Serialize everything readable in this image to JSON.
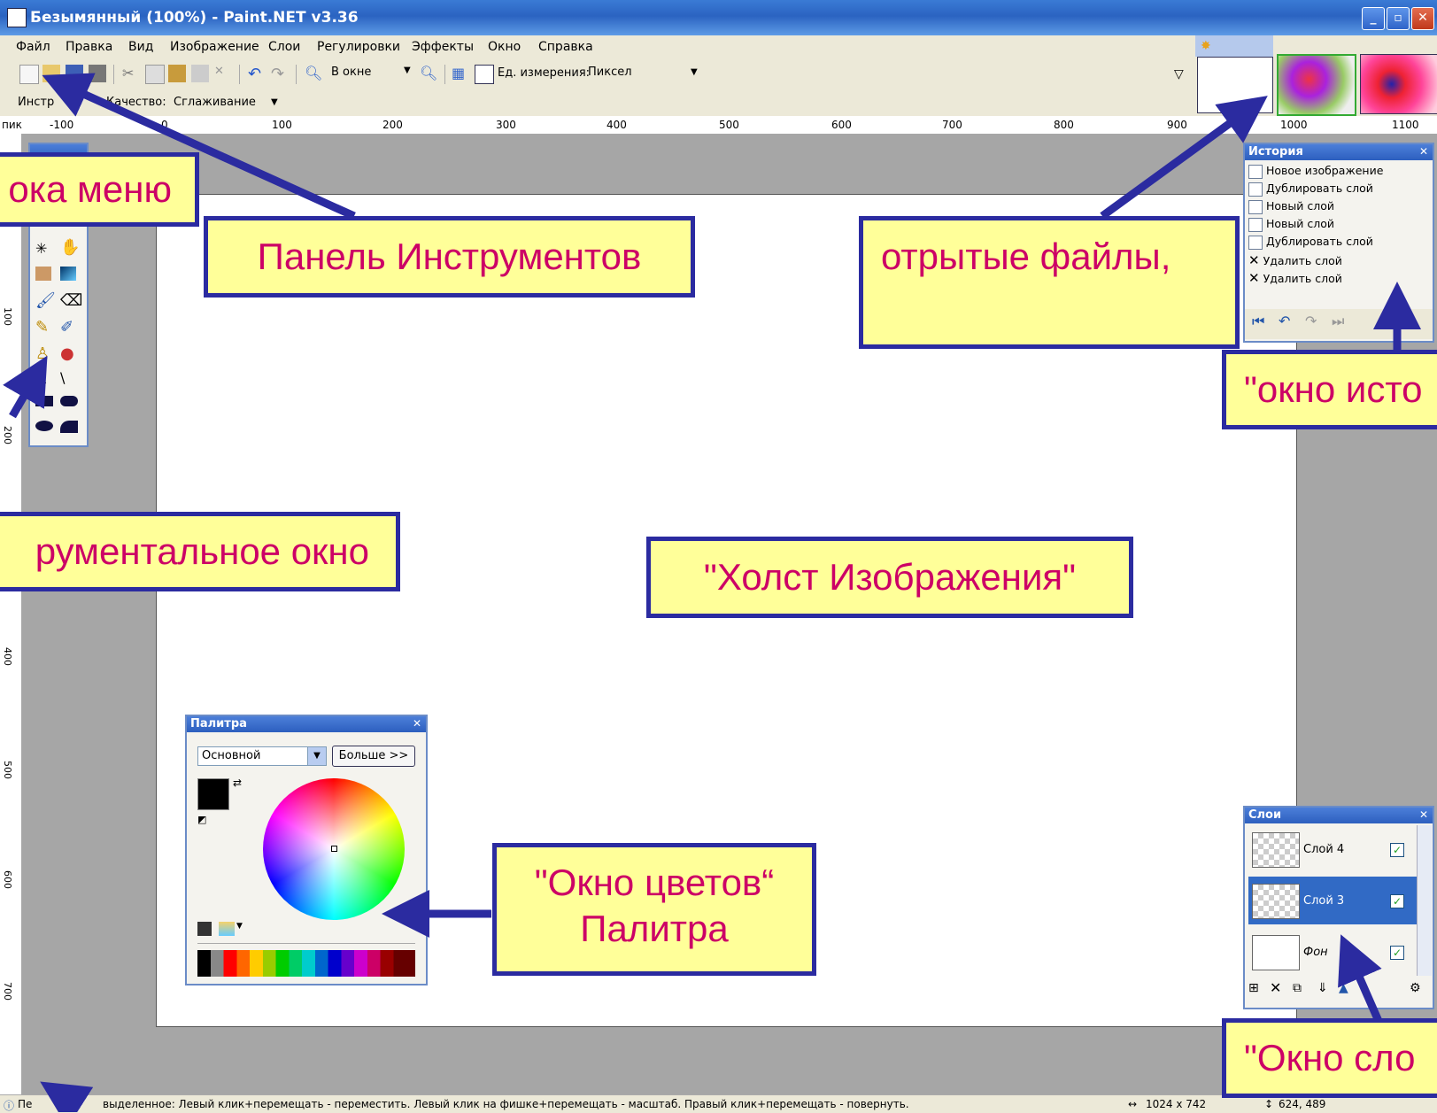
{
  "window": {
    "title": "Безымянный (100%) - Paint.NET v3.36"
  },
  "menu": [
    "Файл",
    "Правка",
    "Вид",
    "Изображение",
    "Слои",
    "Регулировки",
    "Эффекты",
    "Окно",
    "Справка"
  ],
  "toolbar": {
    "zoom_value": "В окне",
    "units_label": "Ед. измерения:",
    "units_value": "Пиксел",
    "tool_label": "Инстр",
    "quality_label": "Качество:",
    "quality_value": "Сглаживание"
  },
  "ruler": {
    "top_ticks": [
      "-100",
      "0",
      "100",
      "200",
      "300",
      "400",
      "500",
      "600",
      "700",
      "800",
      "900",
      "1000",
      "1100"
    ],
    "left_ticks": [
      "100",
      "200",
      "400",
      "500",
      "600",
      "700"
    ],
    "corner": "пик"
  },
  "history": {
    "title": "История",
    "items": [
      "Новое изображение",
      "Дублировать слой",
      "Новый слой",
      "Новый слой",
      "Дублировать слой",
      "Удалить слой",
      "Удалить слой"
    ]
  },
  "palette": {
    "title": "Палитра",
    "dropdown": "Основной",
    "more_button": "Больше >>"
  },
  "layers": {
    "title": "Слои",
    "items": [
      {
        "name": "Слой 4",
        "selected": false
      },
      {
        "name": "Слой 3",
        "selected": true
      },
      {
        "name": "Фон",
        "selected": false
      }
    ]
  },
  "statusbar": {
    "hint_prefix": "Пе",
    "hint": "выделенное: Левый клик+перемещать - переместить. Левый клик на фишке+перемещать - масштаб. Правый клик+перемещать - повернуть.",
    "image_size": "1024 x 742",
    "cursor_pos": "624, 489"
  },
  "callouts": {
    "menu": "ока меню",
    "toolbar": "Панель Инструментов",
    "open_files": "отрытые файлы,",
    "history": "\"окно исто",
    "tools_window": "рументальное окно",
    "canvas": "\"Холст Изображения\"",
    "colors_line1": "\"Окно цветов“",
    "colors_line2": "Палитра",
    "layers": "\"Окно сло"
  },
  "colors": {
    "callout_bg": "#ffff99",
    "callout_border": "#2b2ba0",
    "callout_text": "#cc0066",
    "titlebar": "#2b63c1"
  }
}
